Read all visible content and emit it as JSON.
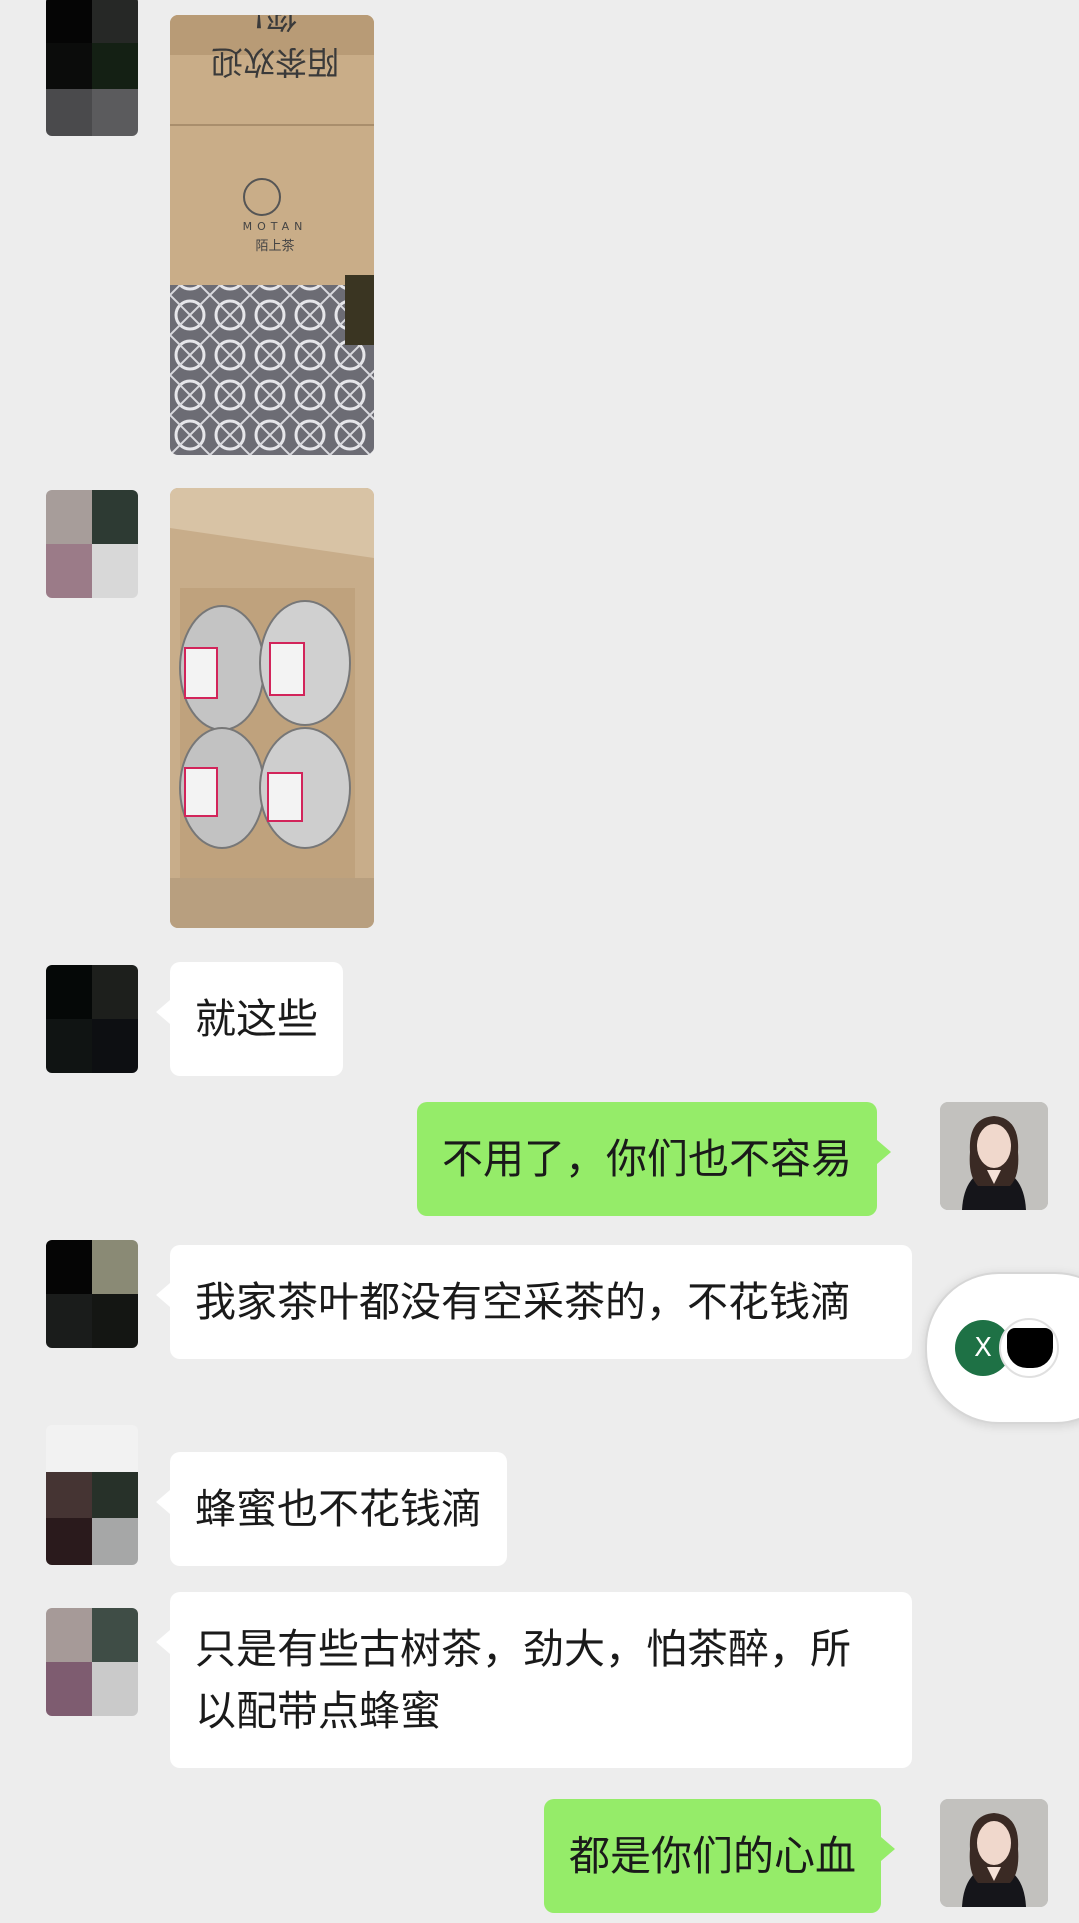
{
  "chat": {
    "messages": [
      {
        "id": 1,
        "side": "left",
        "type": "image",
        "description_icon": "image-photo"
      },
      {
        "id": 2,
        "side": "left",
        "type": "image",
        "description_icon": "image-photo"
      },
      {
        "id": 3,
        "side": "left",
        "type": "text",
        "text": "就这些"
      },
      {
        "id": 4,
        "side": "right",
        "type": "text",
        "text": "不用了，你们也不容易"
      },
      {
        "id": 5,
        "side": "left",
        "type": "text",
        "text": "我家茶叶都没有空采茶的，不花钱滴"
      },
      {
        "id": 6,
        "side": "left",
        "type": "text",
        "text": "蜂蜜也不花钱滴"
      },
      {
        "id": 7,
        "side": "left",
        "type": "text",
        "text": "只是有些古树茶，劲大，怕茶醉，所以配带点蜂蜜"
      },
      {
        "id": 8,
        "side": "right",
        "type": "text",
        "text": "都是你们的心血"
      }
    ]
  },
  "photo1": {
    "box_brand": "MOTAN",
    "box_text_top": "陌茶欢迎您!",
    "box_logo_cn": "陌上茶"
  },
  "floating_widget": {
    "badge_label": "X",
    "icon": "excel-icon"
  },
  "colors": {
    "background": "#ededed",
    "incoming_bubble": "#ffffff",
    "outgoing_bubble": "#95ec69",
    "excel_green": "#1e7145"
  }
}
